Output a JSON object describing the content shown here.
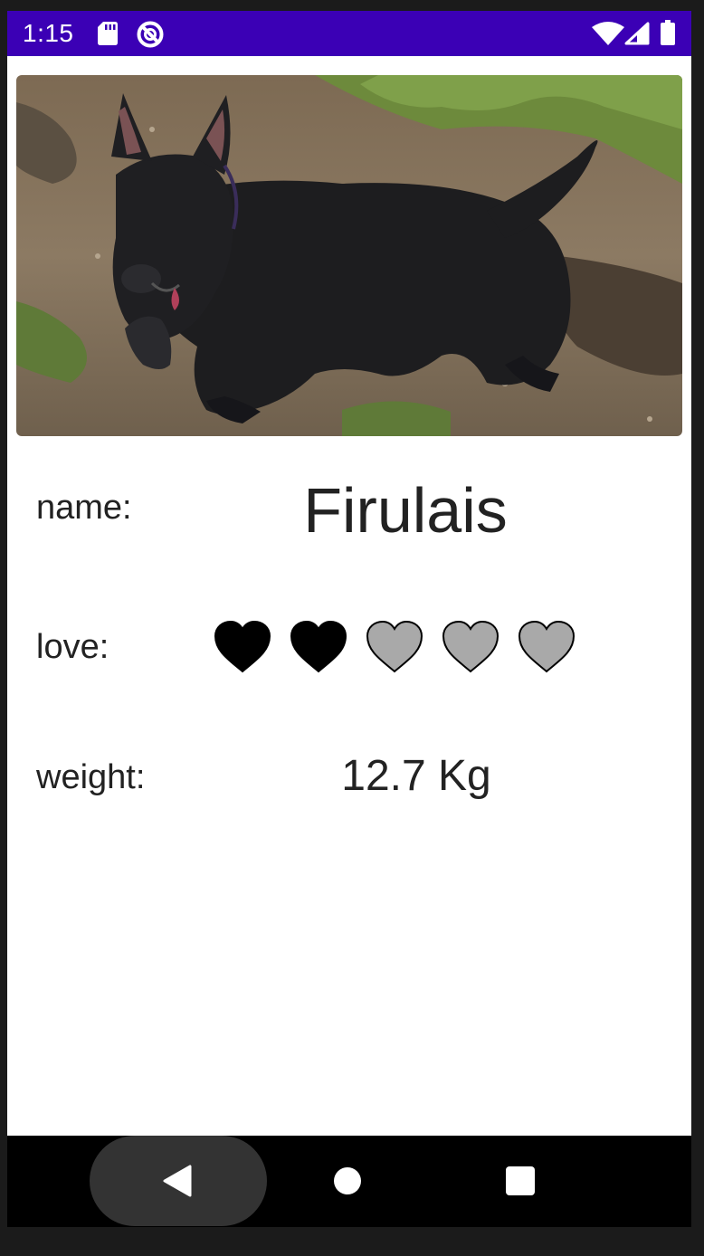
{
  "status_bar": {
    "time": "1:15",
    "background_color": "#3b00b5",
    "icons": [
      "sd-card-icon",
      "do-not-disturb-icon",
      "wifi-icon",
      "cell-signal-icon",
      "battery-icon"
    ]
  },
  "pet": {
    "photo_icon": "dog-photo",
    "name_label": "name:",
    "name": "Firulais",
    "love_label": "love:",
    "love_rating": 2,
    "love_max": 5,
    "love_filled_color": "#000000",
    "love_empty_color": "#a9a9a9",
    "weight_label": "weight:",
    "weight": "12.7 Kg"
  },
  "nav_bar": {
    "icons": [
      "back-icon",
      "home-icon",
      "recents-icon"
    ]
  }
}
